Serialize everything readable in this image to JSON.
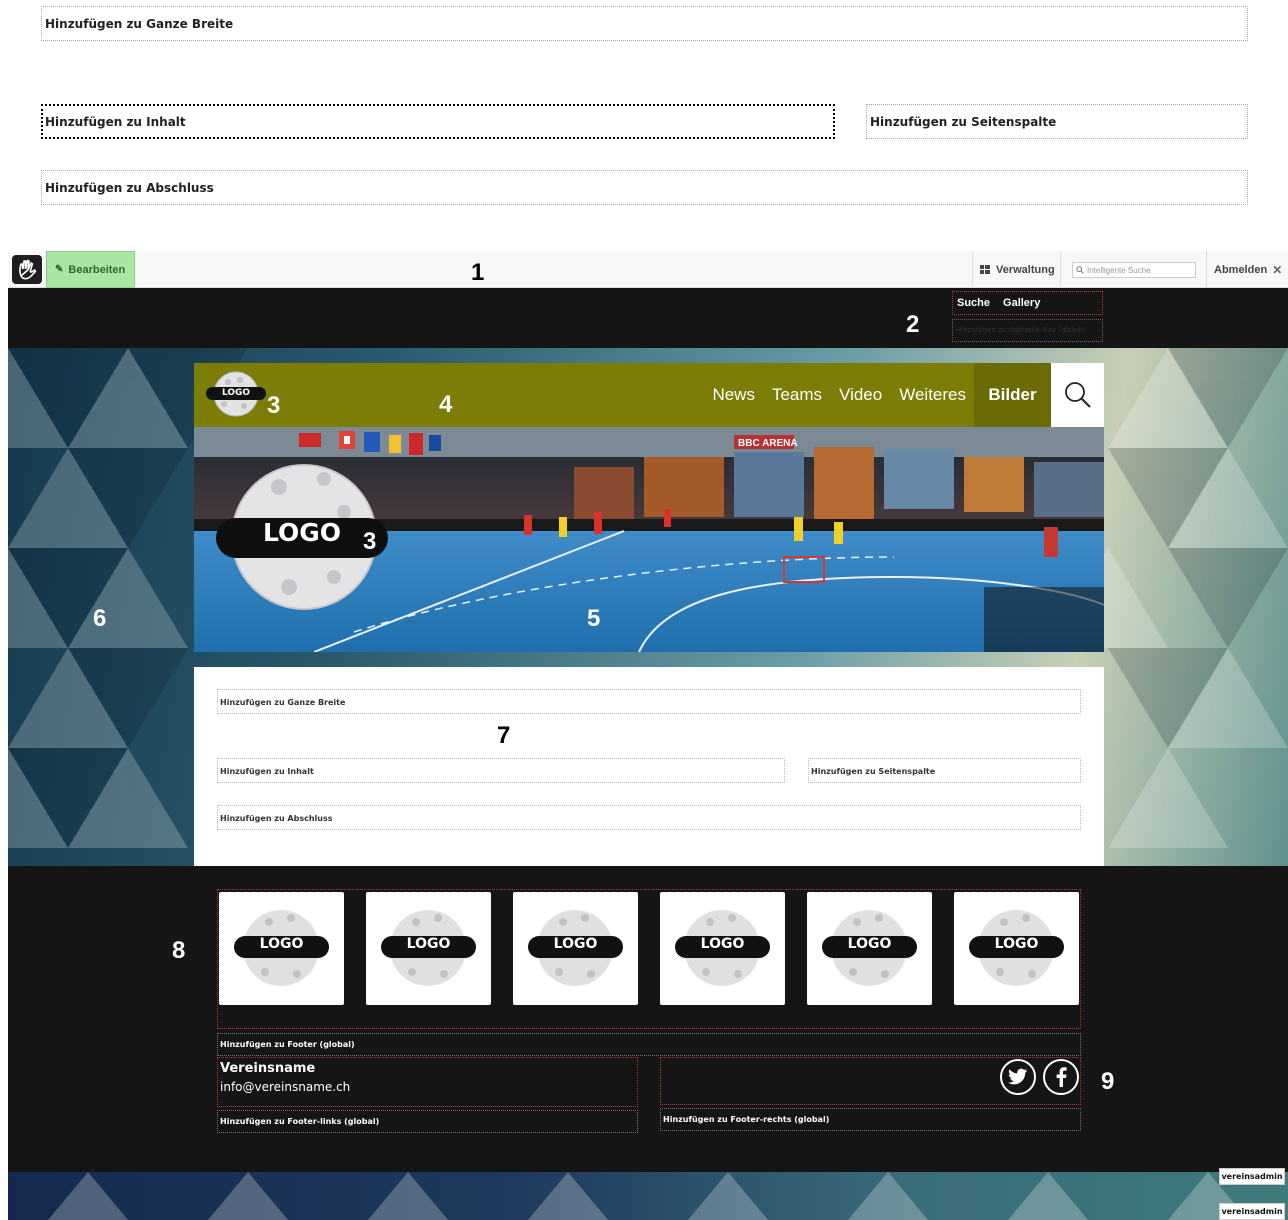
{
  "zoom_areas": {
    "full_width": "Hinzufügen zu Ganze Breite",
    "content": "Hinzufügen zu Inhalt",
    "sidebar": "Hinzufügen zu Seitenspalte",
    "closing": "Hinzufügen zu Abschluss"
  },
  "toolbar": {
    "edit_label": "Bearbeiten",
    "admin_label": "Verwaltung",
    "search_placeholder": "Intelligente Suche",
    "logout_label": "Abmelden"
  },
  "header": {
    "nav_items": [
      "Suche",
      "Gallery"
    ],
    "area_label": "Hinzufügen zu Kopfzeile-Nav (global)"
  },
  "site_nav": {
    "logo_text": "LOGO",
    "links": [
      "News",
      "Teams",
      "Video",
      "Weiteres"
    ],
    "active_link": "Bilder"
  },
  "hero": {
    "logo_text": "LOGO",
    "arena_sign": "BBC ARENA"
  },
  "content_areas": {
    "full_width": "Hinzufügen zu Ganze Breite",
    "content": "Hinzufügen zu Inhalt",
    "sidebar": "Hinzufügen zu Seitenspalte",
    "closing": "Hinzufügen zu Abschluss"
  },
  "footer": {
    "sponsor_logos": [
      "LOGO",
      "LOGO",
      "LOGO",
      "LOGO",
      "LOGO",
      "LOGO"
    ],
    "footer_area": "Hinzufügen zu Footer (global)",
    "club_name": "Vereinsname",
    "club_email": "info@vereinsname.ch",
    "footer_left_area": "Hinzufügen zu Footer-links (global)",
    "footer_right_area": "Hinzufügen zu Footer-rechts (global)",
    "social_icons": [
      "twitter-icon",
      "facebook-icon"
    ]
  },
  "user_badges": [
    "vereinsadmin",
    "vereinsadmin"
  ],
  "markers": [
    "1",
    "2",
    "3",
    "3",
    "4",
    "5",
    "6",
    "7",
    "8",
    "9"
  ],
  "colors": {
    "nav_bg": "#7c7d06",
    "edit_green": "#a9e5a3",
    "dark": "#151515",
    "area_red": "#b33333"
  }
}
